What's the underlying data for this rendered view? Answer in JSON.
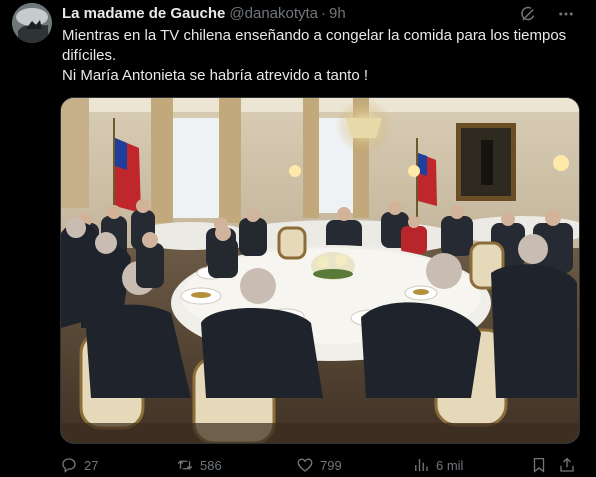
{
  "author": {
    "display_name": "La madame de Gauche",
    "handle": "@danakotyta",
    "separator": "·",
    "time": "9h"
  },
  "tweet": {
    "lines": [
      "Mientras en la TV chilena enseñando a congelar la comida para los tiempos difíciles.",
      "Ni María Antonieta se habría atrevido a tanto !"
    ]
  },
  "media": {
    "kind": "photo",
    "description_icon": "photo-icon"
  },
  "stats": {
    "replies": "27",
    "retweets": "586",
    "likes": "799",
    "views": "6 mil"
  },
  "icons": {
    "grok": "grok-icon",
    "more": "more-icon",
    "reply": "reply-icon",
    "retweet": "retweet-icon",
    "like": "heart-icon",
    "views": "views-icon",
    "bookmark": "bookmark-icon",
    "share": "share-icon"
  },
  "colors": {
    "background": "#000000",
    "text": "#e7e9ea",
    "muted": "#71767b",
    "border": "#2f3336"
  }
}
